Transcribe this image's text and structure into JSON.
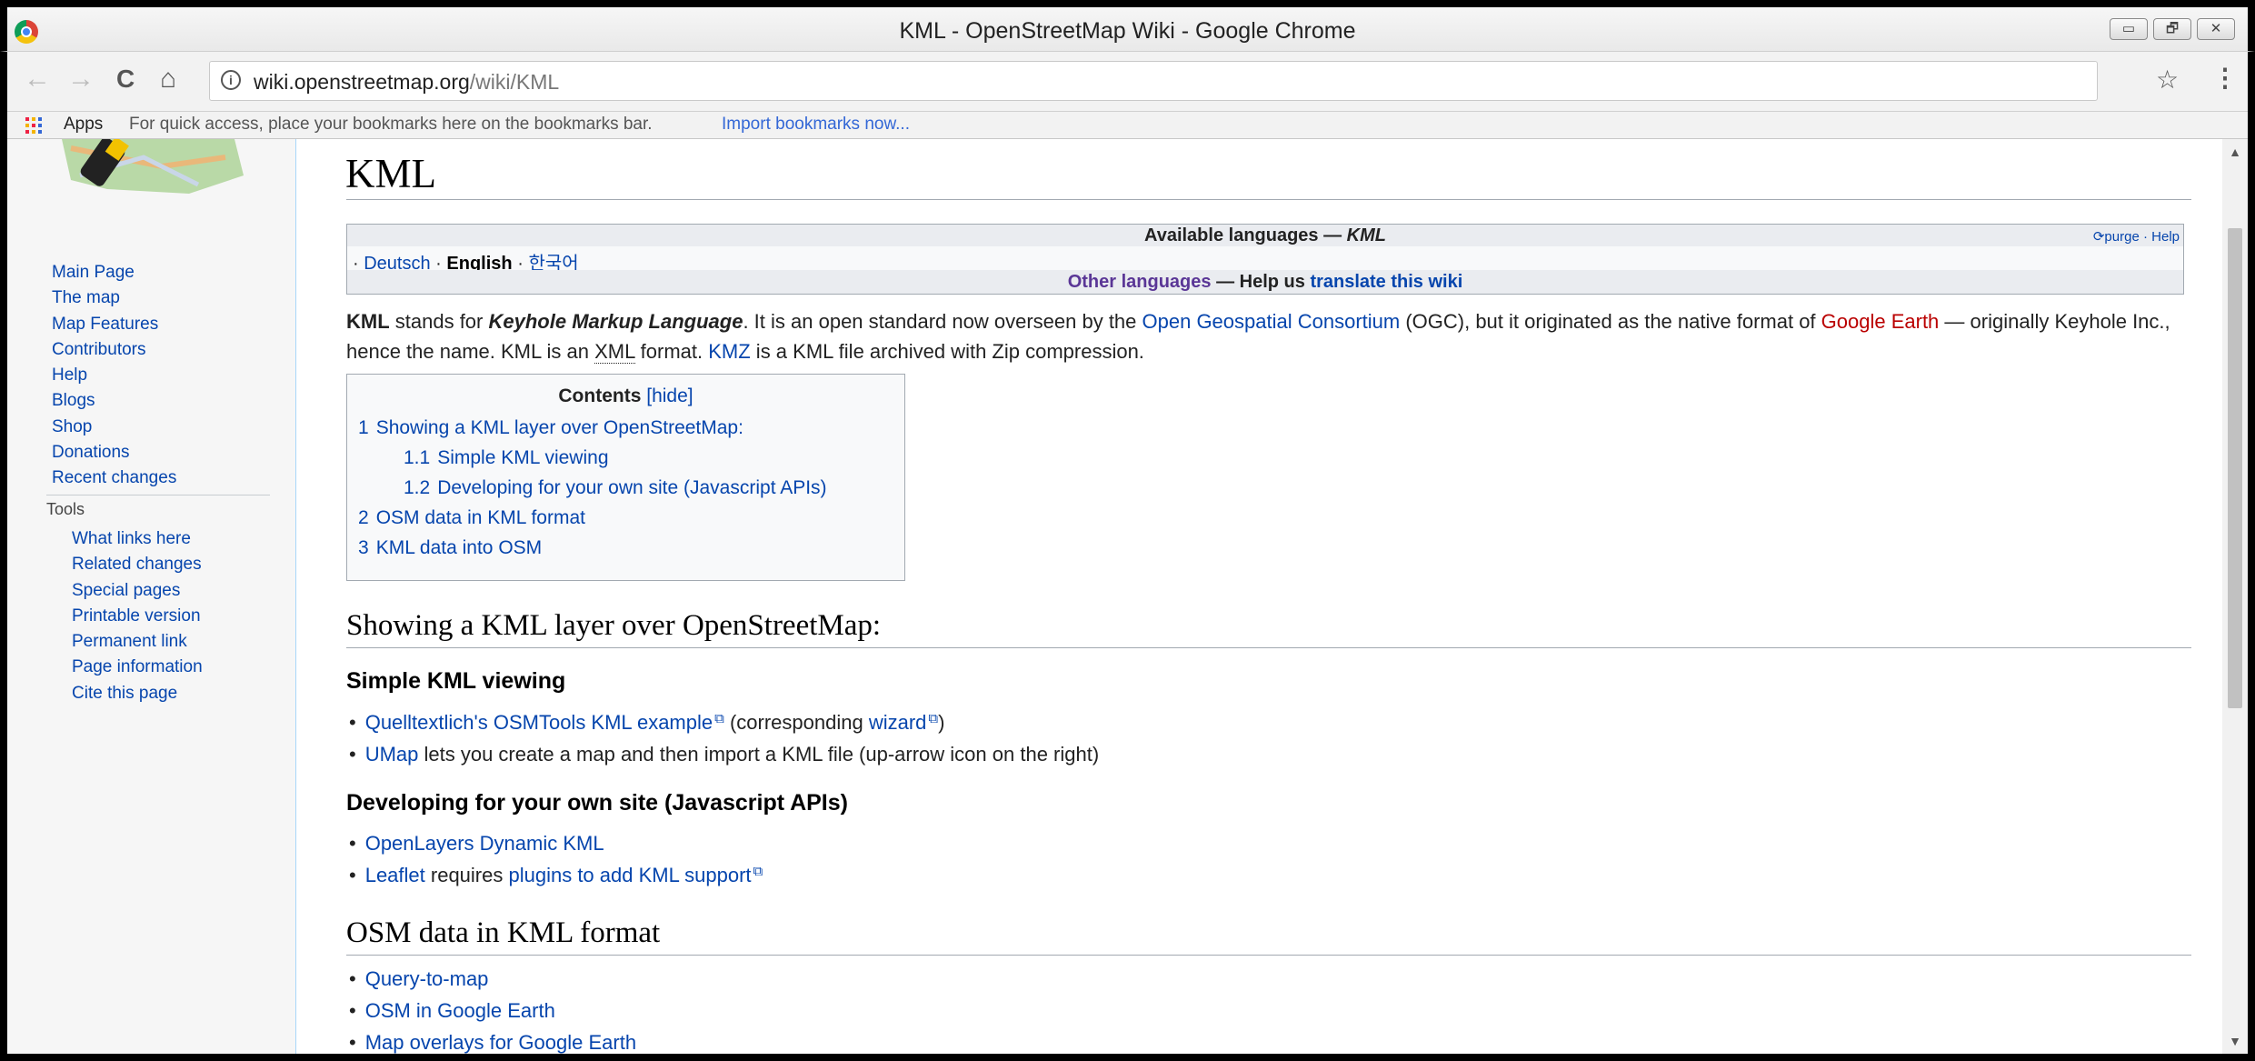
{
  "window": {
    "title": "KML - OpenStreetMap Wiki - Google Chrome",
    "buttons": {
      "minimize": "▭",
      "maximize": "🗗",
      "close": "✕"
    }
  },
  "toolbar": {
    "back": "←",
    "forward": "→",
    "reload": "C",
    "home": "⌂",
    "url_host": "wiki.openstreetmap.org",
    "url_path": "/wiki/KML",
    "star": "☆",
    "menu": "⋮"
  },
  "bookmarks": {
    "apps": "Apps",
    "hint": "For quick access, place your bookmarks here on the bookmarks bar.",
    "import": "Import bookmarks now..."
  },
  "sidebar": {
    "navigation": [
      "Main Page",
      "The map",
      "Map Features",
      "Contributors",
      "Help",
      "Blogs",
      "Shop",
      "Donations",
      "Recent changes"
    ],
    "tools_heading": "Tools",
    "tools": [
      "What links here",
      "Related changes",
      "Special pages",
      "Printable version",
      "Permanent link",
      "Page information",
      "Cite this page"
    ]
  },
  "page": {
    "title": "KML",
    "languages": {
      "heading": "Available languages —",
      "heading_term": "KML",
      "purge": "purge",
      "help": "Help",
      "separator": "·",
      "list": [
        "Deutsch",
        "English",
        "한국어"
      ],
      "other_a": "Other languages",
      "other_b": "— Help us",
      "other_c": "translate this wiki"
    },
    "intro": {
      "t1": "KML",
      "t2": " stands for ",
      "t3": "Keyhole Markup Language",
      "t4": ". It is an open standard now overseen by the ",
      "t5": "Open Geospatial Consortium",
      "t6": " (OGC), but it originated as the native format of ",
      "t7": "Google Earth",
      "t8": " — originally Keyhole Inc., hence the name. KML is an ",
      "t9": "XML",
      "t10": " format. ",
      "t11": "KMZ",
      "t12": " is a KML file archived with Zip compression."
    },
    "toc": {
      "title": "Contents",
      "hide": "[hide]",
      "items": [
        {
          "num": "1",
          "label": "Showing a KML layer over OpenStreetMap:"
        },
        {
          "num": "1.1",
          "label": "Simple KML viewing"
        },
        {
          "num": "1.2",
          "label": "Developing for your own site (Javascript APIs)"
        },
        {
          "num": "2",
          "label": "OSM data in KML format"
        },
        {
          "num": "3",
          "label": "KML data into OSM"
        }
      ]
    },
    "sections": {
      "s1": "Showing a KML layer over OpenStreetMap:",
      "s1_1": "Simple KML viewing",
      "s1_1_b1_link": "Quelltextlich's OSMTools KML example",
      "s1_1_b1_mid": " (corresponding ",
      "s1_1_b1_link2": "wizard",
      "s1_1_b1_end": ")",
      "s1_1_b2_link": "UMap",
      "s1_1_b2_text": " lets you create a map and then import a KML file (up-arrow icon on the right)",
      "s1_2": "Developing for your own site (Javascript APIs)",
      "s1_2_b1_link": "OpenLayers Dynamic KML",
      "s1_2_b2_link": "Leaflet",
      "s1_2_b2_mid": " requires ",
      "s1_2_b2_link2": "plugins to add KML support",
      "s2": "OSM data in KML format",
      "s2_b1": "Query-to-map",
      "s2_b2": "OSM in Google Earth",
      "s2_b3": "Map overlays for Google Earth"
    }
  }
}
